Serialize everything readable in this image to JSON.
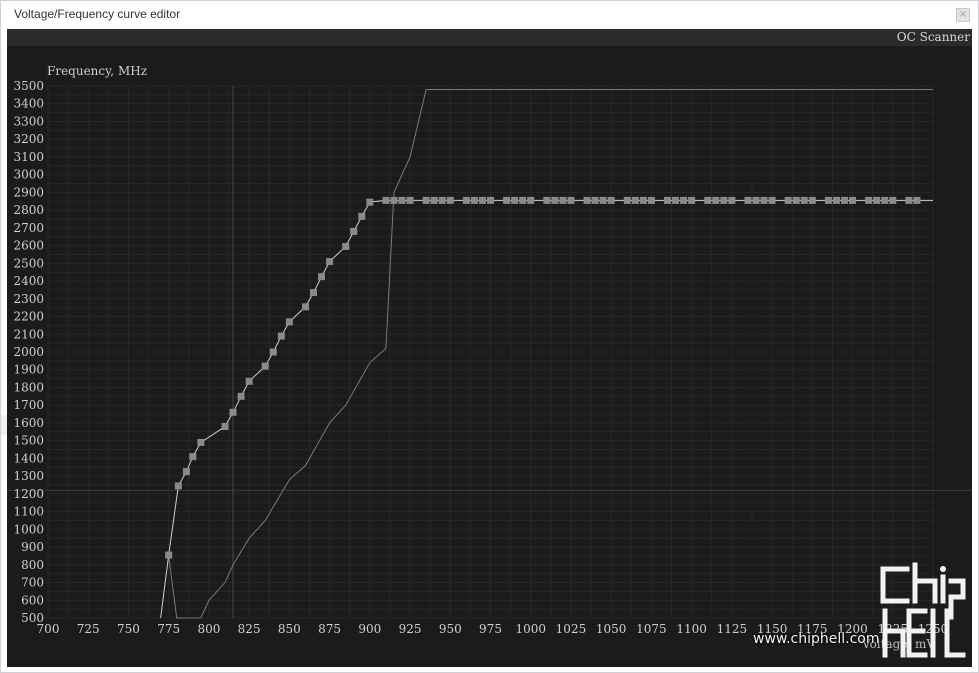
{
  "window": {
    "title": "Voltage/Frequency curve editor",
    "close_glyph": "×"
  },
  "toolbar": {
    "oc_scanner_label": "OC Scanner"
  },
  "chart_data": {
    "type": "line",
    "ylabel": "Frequency, MHz",
    "xlabel": "Voltage, mV",
    "xlim": [
      700,
      1250
    ],
    "ylim": [
      500,
      3500
    ],
    "x_ticks": [
      700,
      725,
      750,
      775,
      800,
      825,
      850,
      875,
      900,
      925,
      950,
      975,
      1000,
      1025,
      1050,
      1075,
      1100,
      1125,
      1150,
      1175,
      1200,
      1225,
      1250
    ],
    "y_ticks": [
      500,
      600,
      700,
      800,
      900,
      1000,
      1100,
      1200,
      1300,
      1400,
      1500,
      1600,
      1700,
      1800,
      1900,
      2000,
      2100,
      2200,
      2300,
      2400,
      2500,
      2600,
      2700,
      2800,
      2900,
      3000,
      3100,
      3200,
      3300,
      3400,
      3500
    ],
    "grid": true,
    "vertical_marker_x": 815,
    "horizontal_marker_y": 1220,
    "series": [
      {
        "role": "edited-curve",
        "color": "#cfcfcf",
        "x": [
          770,
          775,
          781,
          786,
          790,
          795,
          810,
          815,
          820,
          825,
          835,
          840,
          845,
          850,
          860,
          865,
          870,
          875,
          885,
          890,
          895,
          900,
          910,
          915,
          920,
          925,
          935,
          940,
          945,
          950,
          960,
          965,
          970,
          975,
          985,
          990,
          995,
          1000,
          1010,
          1015,
          1020,
          1025,
          1035,
          1040,
          1045,
          1050,
          1060,
          1065,
          1070,
          1075,
          1085,
          1090,
          1095,
          1100,
          1110,
          1115,
          1120,
          1125,
          1135,
          1140,
          1145,
          1150,
          1160,
          1165,
          1170,
          1175,
          1185,
          1190,
          1195,
          1200,
          1210,
          1215,
          1220,
          1225,
          1235,
          1240,
          1250
        ],
        "y": [
          500,
          855,
          1245,
          1325,
          1410,
          1490,
          1580,
          1660,
          1750,
          1835,
          1920,
          2000,
          2090,
          2170,
          2255,
          2335,
          2425,
          2510,
          2595,
          2680,
          2765,
          2845,
          2855,
          2855,
          2855,
          2855,
          2855,
          2855,
          2855,
          2855,
          2855,
          2855,
          2855,
          2855,
          2855,
          2855,
          2855,
          2855,
          2855,
          2855,
          2855,
          2855,
          2855,
          2855,
          2855,
          2855,
          2855,
          2855,
          2855,
          2855,
          2855,
          2855,
          2855,
          2855,
          2855,
          2855,
          2855,
          2855,
          2855,
          2855,
          2855,
          2855,
          2855,
          2855,
          2855,
          2855,
          2855,
          2855,
          2855,
          2855,
          2855,
          2855,
          2855,
          2855,
          2855,
          2855,
          2855
        ]
      },
      {
        "role": "default-curve",
        "color": "#7a7a7a",
        "x": [
          775,
          780,
          795,
          800,
          810,
          815,
          825,
          835,
          850,
          860,
          875,
          885,
          895,
          900,
          910,
          915,
          925,
          935,
          1250
        ],
        "y": [
          850,
          500,
          500,
          600,
          700,
          800,
          950,
          1050,
          1280,
          1360,
          1600,
          1700,
          1860,
          1940,
          2020,
          2900,
          3100,
          3480,
          3480
        ]
      }
    ],
    "marker_color": "#8a8a8a"
  },
  "watermark": {
    "logo_text": "chip hell",
    "url": "www.chiphell.com"
  }
}
